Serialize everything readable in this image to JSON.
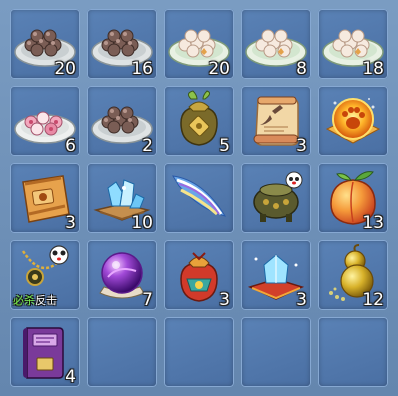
{
  "colors": {
    "slot": "#4f76aa",
    "slot_border": "#86a8d2",
    "count_text": "#ffffff",
    "tag_green": "#7cf04a"
  },
  "items": [
    {
      "icon": "dumpling-plate-icon",
      "count": "20"
    },
    {
      "icon": "dumpling-plate-icon",
      "count": "16"
    },
    {
      "icon": "tangyuan-plate-icon",
      "count": "20"
    },
    {
      "icon": "tangyuan-plate-icon",
      "count": "8"
    },
    {
      "icon": "tangyuan-plate-icon",
      "count": "18"
    },
    {
      "icon": "flower-cake-plate-icon",
      "count": "6"
    },
    {
      "icon": "dumpling-plate-icon",
      "count": "2"
    },
    {
      "icon": "money-bag-icon",
      "count": "5"
    },
    {
      "icon": "scroll-icon",
      "count": "3"
    },
    {
      "icon": "golden-paw-orb-icon",
      "count": ""
    },
    {
      "icon": "treasure-map-icon",
      "count": "3"
    },
    {
      "icon": "ice-crystal-icon",
      "count": "10"
    },
    {
      "icon": "feather-wing-icon",
      "count": ""
    },
    {
      "icon": "bronze-cauldron-icon",
      "count": ""
    },
    {
      "icon": "peach-icon",
      "count": "13"
    },
    {
      "icon": "panda-necklace-icon",
      "count": "",
      "tag_left": "必杀",
      "tag_right": "反击"
    },
    {
      "icon": "purple-orb-icon",
      "count": "7"
    },
    {
      "icon": "lucky-bag-icon",
      "count": "3"
    },
    {
      "icon": "crystal-cushion-icon",
      "count": "3"
    },
    {
      "icon": "gourd-icon",
      "count": "12"
    },
    {
      "icon": "purple-book-icon",
      "count": "4"
    },
    {
      "icon": "",
      "count": ""
    },
    {
      "icon": "",
      "count": ""
    },
    {
      "icon": "",
      "count": ""
    },
    {
      "icon": "",
      "count": ""
    }
  ]
}
